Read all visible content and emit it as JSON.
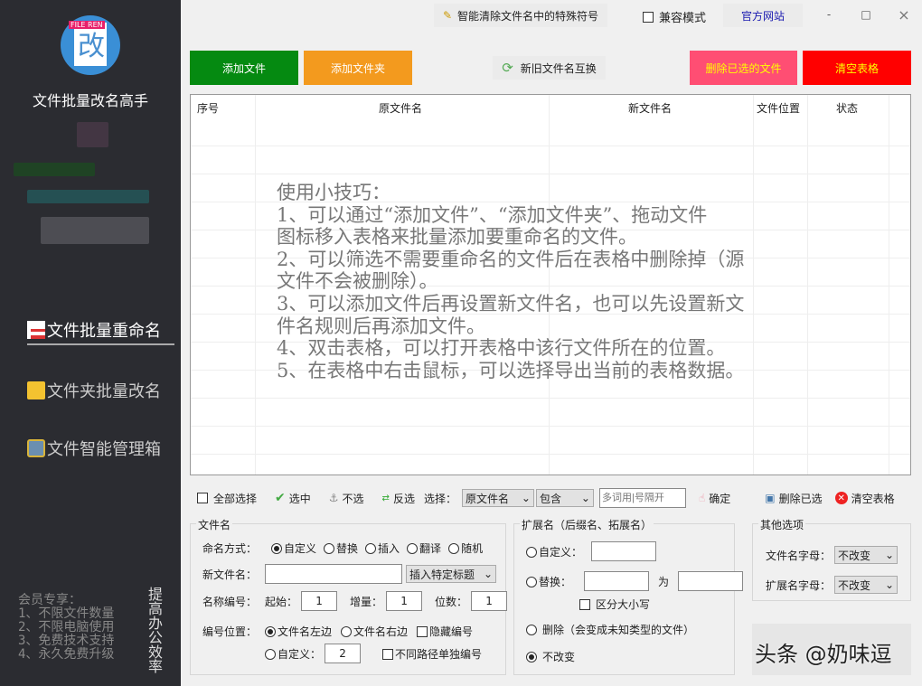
{
  "app": {
    "title": "文件批量改名高手",
    "logo_tag": "FILE REN",
    "logo_char": "改"
  },
  "sidebar": {
    "nav": [
      {
        "label": "文件批量重命名"
      },
      {
        "label": "文件夹批量改名"
      },
      {
        "label": "文件智能管理箱"
      }
    ],
    "vip_text": "会员专享：\n1、不限文件数量\n2、不限电脑使用\n3、免费技术支持\n4、永久免费升级",
    "slogan": "提高办公效率"
  },
  "titlebar": {
    "clean_symbols": "智能清除文件名中的特殊符号",
    "compat_mode": "兼容模式",
    "website": "官方网站",
    "minimize": "-",
    "maximize": "□",
    "close": "×"
  },
  "toolbar": {
    "add_file": "添加文件",
    "add_folder": "添加文件夹",
    "swap_names": "新旧文件名互换",
    "delete_selected_files": "删除已选的文件",
    "clear_table": "清空表格",
    "colors": {
      "add_file": "#058a11",
      "add_folder": "#f39a1e",
      "delete": "#ff4e73",
      "clear": "#ff0000"
    }
  },
  "table": {
    "columns": [
      "序号",
      "原文件名",
      "新文件名",
      "文件位置",
      "状态"
    ],
    "tips": "使用小技巧：\n1、可以通过“添加文件”、“添加文件夹”、拖动文件\n图标移入表格来批量添加要重命名的文件。\n2、可以筛选不需要重命名的文件后在表格中删除掉（源\n文件不会被删除）。\n3、可以添加文件后再设置新文件名，也可以先设置新文\n件名规则后再添加文件。\n4、双击表格，可以打开表格中该行文件所在的位置。\n5、在表格中右击鼠标，可以选择导出当前的表格数据。"
  },
  "filterbar": {
    "select_all": "全部选择",
    "check": "选中",
    "uncheck": "不选",
    "invert": "反选",
    "select_label": "选择：",
    "field": "原文件名",
    "match": "包含",
    "keyword_placeholder": "多词用|号隔开",
    "confirm": "确定",
    "delete_selected": "删除已选",
    "clear_table": "清空表格"
  },
  "filename": {
    "title": "文件名",
    "mode_label": "命名方式：",
    "modes": [
      "自定义",
      "替换",
      "插入",
      "翻译",
      "随机"
    ],
    "new_name_label": "新文件名：",
    "new_name_value": "",
    "insert_title": "插入特定标题",
    "number_label": "名称编号：",
    "start_label": "起始：",
    "start": "1",
    "step_label": "增量：",
    "step": "1",
    "digits_label": "位数：",
    "digits": "1",
    "pos_label": "编号位置：",
    "pos_left": "文件名左边",
    "pos_right": "文件名右边",
    "hide_number": "隐藏编号",
    "custom": "自定义：",
    "custom_value": "2",
    "separate_paths": "不同路径单独编号"
  },
  "extension": {
    "title": "扩展名（后缀名、拓展名）",
    "custom": "自定义：",
    "replace": "替换：",
    "to": "为",
    "case_sensitive": "区分大小写",
    "delete": "删除（会变成未知类型的文件）",
    "unchanged": "不改变"
  },
  "other": {
    "title": "其他选项",
    "filename_case_label": "文件名字母：",
    "filename_case": "不改变",
    "ext_case_label": "扩展名字母：",
    "ext_case": "不改变"
  },
  "watermark": "头条 @奶味逗"
}
